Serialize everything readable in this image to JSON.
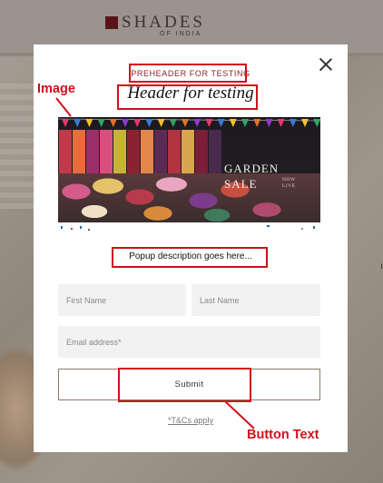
{
  "background": {
    "logo_text": "SHADES",
    "logo_subtext": "OF INDIA",
    "side_mark": "ı"
  },
  "popup": {
    "preheader": "PREHEADER FOR TESTING",
    "header": "Header for testing",
    "banner": {
      "title_line1": "GARDEN",
      "title_line2": "SALE",
      "badge_line1": "NOW",
      "badge_line2": "LIVE"
    },
    "description": "Popup description goes here...",
    "form": {
      "first_name_placeholder": "First Name",
      "last_name_placeholder": "Last Name",
      "email_placeholder": "Email address*",
      "submit_label": "Submit"
    },
    "terms_link": "*T&Cs apply",
    "close_icon": "close-icon"
  },
  "annotations": {
    "image_label": "Image",
    "button_text_label": "Button Text",
    "color": "#d01019"
  },
  "colors": {
    "preheader": "#8b1e2b",
    "brand_mark": "#5a1416",
    "submit_border": "#8a7a6a"
  }
}
